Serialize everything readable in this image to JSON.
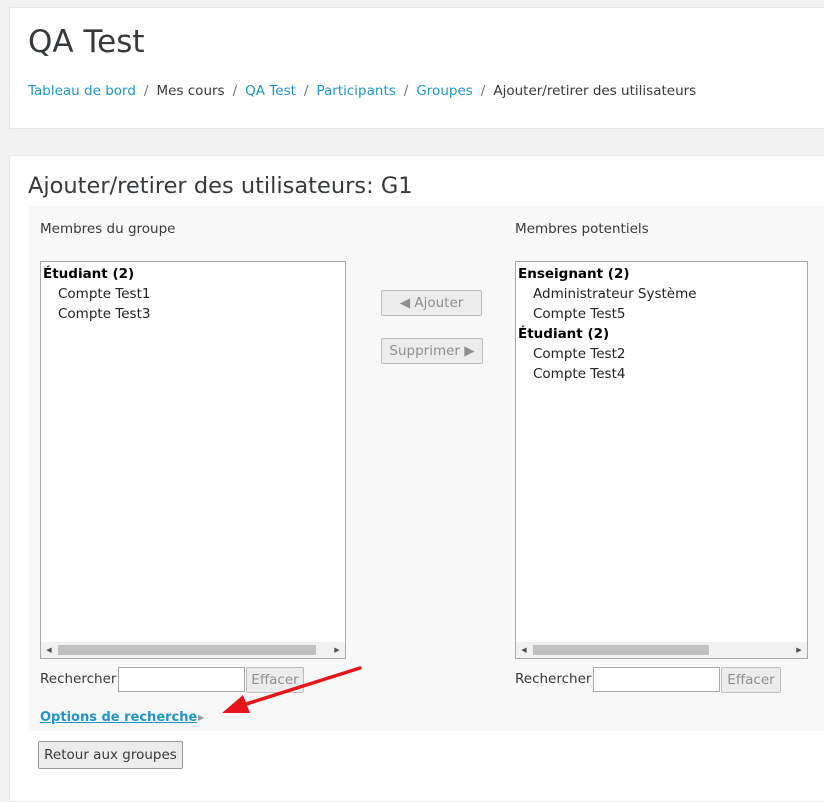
{
  "header": {
    "course_title": "QA Test",
    "breadcrumb": [
      "Tableau de bord",
      "Mes cours",
      "QA Test",
      "Participants",
      "Groupes",
      "Ajouter/retirer des utilisateurs"
    ],
    "separator": "/"
  },
  "main": {
    "page_title": "Ajouter/retirer des utilisateurs: G1",
    "members": {
      "label": "Membres du groupe",
      "groups": [
        {
          "heading": "Étudiant (2)",
          "items": [
            "Compte Test1",
            "Compte Test3"
          ]
        }
      ],
      "search_label": "Rechercher",
      "search_value": "",
      "clear_label": "Effacer"
    },
    "potential": {
      "label": "Membres potentiels",
      "groups": [
        {
          "heading": "Enseignant (2)",
          "items": [
            "Administrateur Système",
            "Compte Test5"
          ]
        },
        {
          "heading": "Étudiant (2)",
          "items": [
            "Compte Test2",
            "Compte Test4"
          ]
        }
      ],
      "search_label": "Rechercher",
      "search_value": "",
      "clear_label": "Effacer"
    },
    "add_label": "◀ Ajouter",
    "remove_label": "Supprimer ▶",
    "search_options_label": "Options de recherche",
    "back_label": "Retour aux groupes"
  },
  "colors": {
    "link": "#2196c6",
    "annotation_arrow": "#e8141b",
    "text": "#373a3c"
  },
  "icons": {
    "scroll_left": "triangle-left-icon",
    "scroll_right": "triangle-right-icon",
    "collapse": "triangle-right-icon"
  }
}
